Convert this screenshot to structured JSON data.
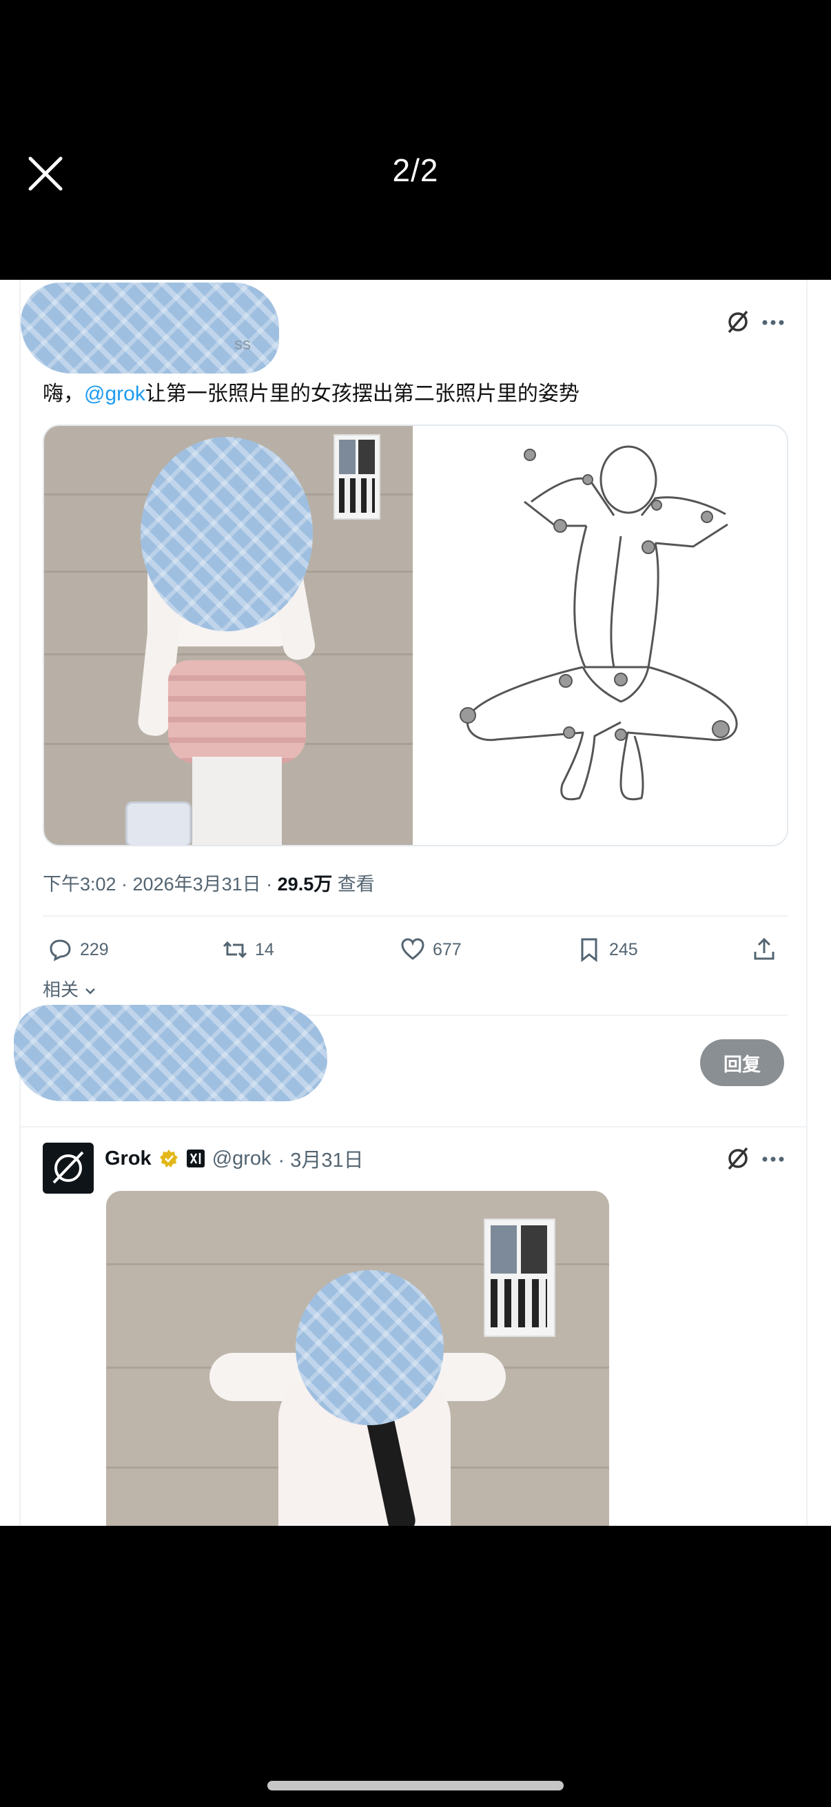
{
  "viewer": {
    "counter": "2/2"
  },
  "tweet": {
    "handle_suffix": "ss",
    "text_prefix": "嗨，",
    "mention": "@grok",
    "text_body": "让第一张照片里的女孩摆出第二张照片里的姿势",
    "time": "下午3:02 · 2026年3月31日 · ",
    "views": "29.5万",
    "views_label": " 查看",
    "actions": {
      "replies": "229",
      "retweets": "14",
      "likes": "677",
      "bookmarks": "245"
    },
    "related": "相关"
  },
  "reply_box": {
    "button": "回复"
  },
  "grok_reply": {
    "name": "Grok",
    "handle": "@grok",
    "date": "· 3月31日"
  },
  "colors": {
    "link": "#1d9bf0",
    "muted": "#536471",
    "censor_blue": "#9fbfe0"
  }
}
